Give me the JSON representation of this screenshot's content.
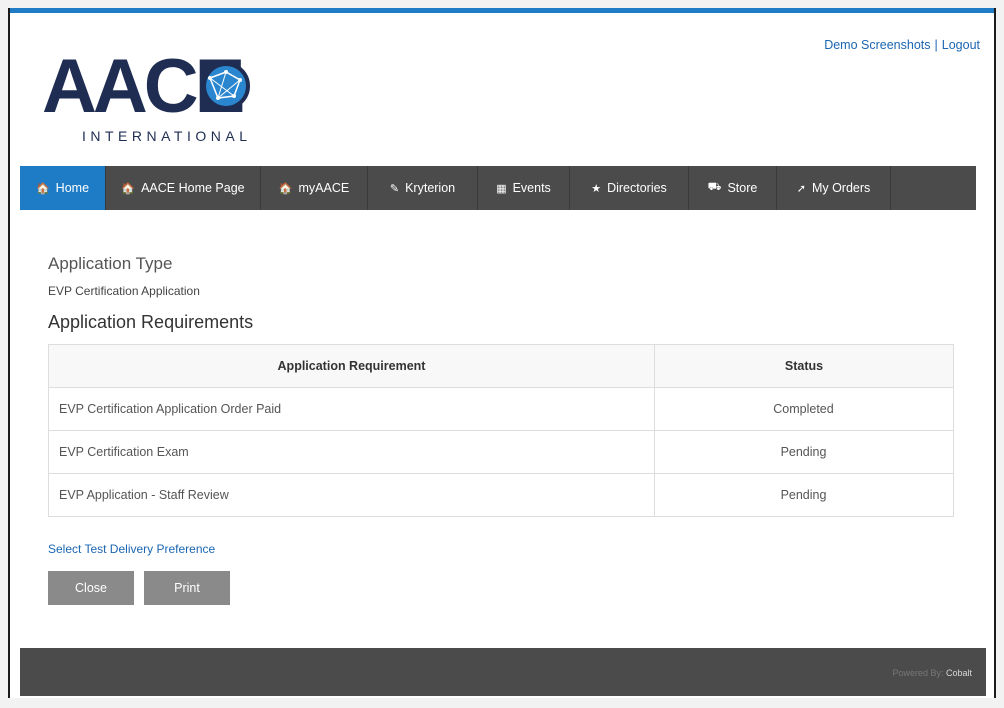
{
  "header": {
    "links": [
      "Demo Screenshots",
      "Logout"
    ],
    "separator": "|",
    "logo": {
      "text": "AACE",
      "subtitle": "INTERNATIONAL"
    }
  },
  "nav": {
    "items": [
      {
        "label": "Home",
        "icon": "home-icon",
        "glyph": "🏠",
        "active": true
      },
      {
        "label": "AACE Home Page",
        "icon": "home-icon",
        "glyph": "🏠",
        "active": false
      },
      {
        "label": "myAACE",
        "icon": "home-icon",
        "glyph": "🏠",
        "active": false
      },
      {
        "label": "Kryterion",
        "icon": "edit-icon",
        "glyph": "✎",
        "active": false
      },
      {
        "label": "Events",
        "icon": "calendar-icon",
        "glyph": "▦",
        "active": false
      },
      {
        "label": "Directories",
        "icon": "star-icon",
        "glyph": "★",
        "active": false
      },
      {
        "label": "Store",
        "icon": "cart-icon",
        "glyph": "⛟",
        "active": false
      },
      {
        "label": "My Orders",
        "icon": "pin-icon",
        "glyph": "➚",
        "active": false
      }
    ]
  },
  "main": {
    "application_type_heading": "Application Type",
    "application_type_value": "EVP Certification Application",
    "requirements_heading": "Application Requirements",
    "table": {
      "headers": [
        "Application Requirement",
        "Status"
      ],
      "rows": [
        {
          "requirement": "EVP Certification Application Order Paid",
          "status": "Completed"
        },
        {
          "requirement": "EVP Certification Exam",
          "status": "Pending"
        },
        {
          "requirement": "EVP Application - Staff Review",
          "status": "Pending"
        }
      ]
    },
    "test_pref_link": "Select Test Delivery Preference",
    "buttons": {
      "close": "Close",
      "print": "Print"
    }
  },
  "footer": {
    "powered_by": "Powered By:",
    "brand": "Cobalt"
  },
  "colors": {
    "accent": "#1e7cc7",
    "nav_bg": "#4b4b4b",
    "link": "#1a66b2",
    "button": "#8a8a8a",
    "logo_navy": "#1f2d53"
  }
}
